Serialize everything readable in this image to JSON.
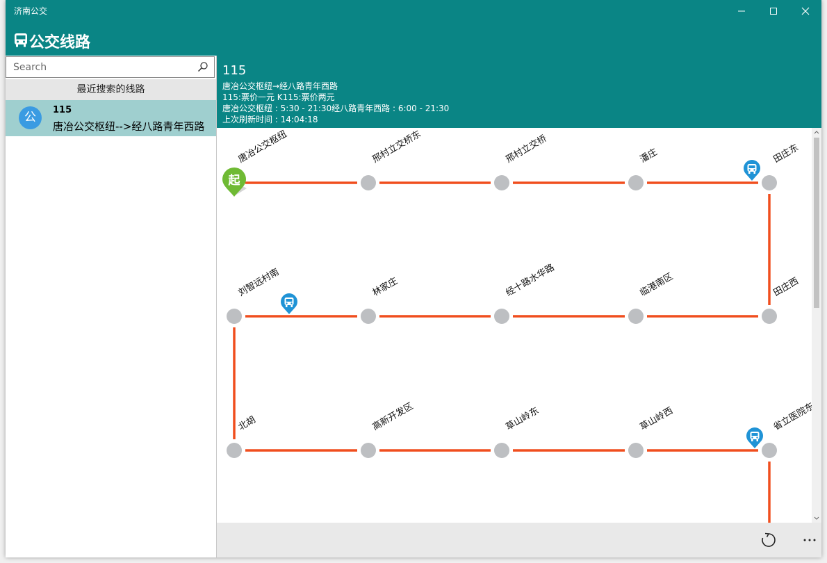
{
  "window": {
    "title": "济南公交"
  },
  "app": {
    "title": "公交线路"
  },
  "search": {
    "placeholder": "Search",
    "value": ""
  },
  "recent": {
    "header": "最近搜索的线路",
    "items": [
      {
        "avatar": "公",
        "number": "115",
        "desc": "唐冶公交枢纽-->经八路青年西路"
      }
    ]
  },
  "route": {
    "number": "115",
    "direction": "唐冶公交枢纽→经八路青年西路",
    "fares": "115:票价一元  K115:票价两元",
    "hours": "唐冶公交枢纽 : 5:30 - 21:30经八路青年西路 : 6:00 - 21:30",
    "refresh": "上次刷新时间 : 14:04:18"
  },
  "map": {
    "line_color": "#f04e1e",
    "stop_color": "#bdbfc2",
    "start_marker_label": "起",
    "start_marker_color": "#6fba34",
    "bus_marker_color": "#1f93d6",
    "stops": [
      "唐冶公交枢纽",
      "邢村立交桥东",
      "邢村立交桥",
      "潘庄",
      "田庄东",
      "田庄西",
      "临港南区",
      "经十路水华路",
      "林家庄",
      "刘智远村南",
      "北胡",
      "高新开发区",
      "草山岭东",
      "草山岭西",
      "省立医院东"
    ],
    "buses_near": [
      "田庄东",
      "刘智远村南",
      "省立医院东"
    ]
  },
  "icons": [
    "bus-icon",
    "search-icon",
    "minimize-icon",
    "maximize-icon",
    "close-icon",
    "refresh-icon",
    "more-icon"
  ]
}
